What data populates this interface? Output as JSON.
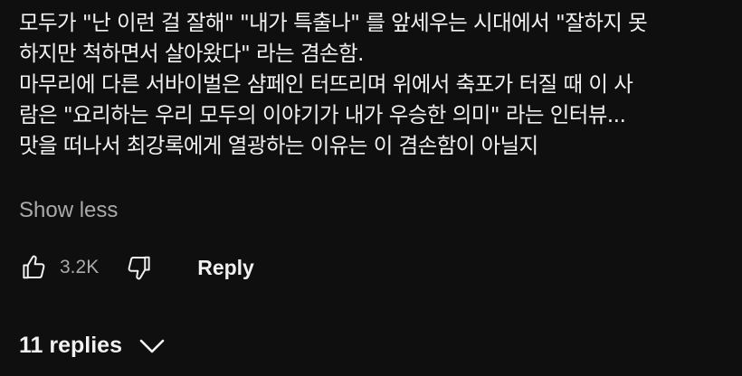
{
  "comment": {
    "lines": [
      "모두가 \"난 이런 걸 잘해\" \"내가 특출나\" 를 앞세우는 시대에서 \"잘하지 못",
      "하지만 척하면서 살아왔다\" 라는 겸손함.",
      "마무리에 다른 서바이벌은 샴페인 터뜨리며 위에서 축포가 터질 때 이 사",
      "람은 \"요리하는 우리 모두의 이야기가 내가 우승한 의미\" 라는 인터뷰...",
      "맛을 떠나서 최강록에게 열광하는 이유는 이 겸손함이 아닐지"
    ],
    "show_less_label": "Show less"
  },
  "actions": {
    "like_icon": "thumbs-up-icon",
    "like_count": "3.2K",
    "dislike_icon": "thumbs-down-icon",
    "reply_label": "Reply"
  },
  "replies": {
    "label": "11 replies",
    "icon": "chevron-down-icon"
  },
  "colors": {
    "background": "#0f0f0f",
    "text_primary": "#f1f1f1",
    "text_secondary": "#aaaaaa"
  }
}
